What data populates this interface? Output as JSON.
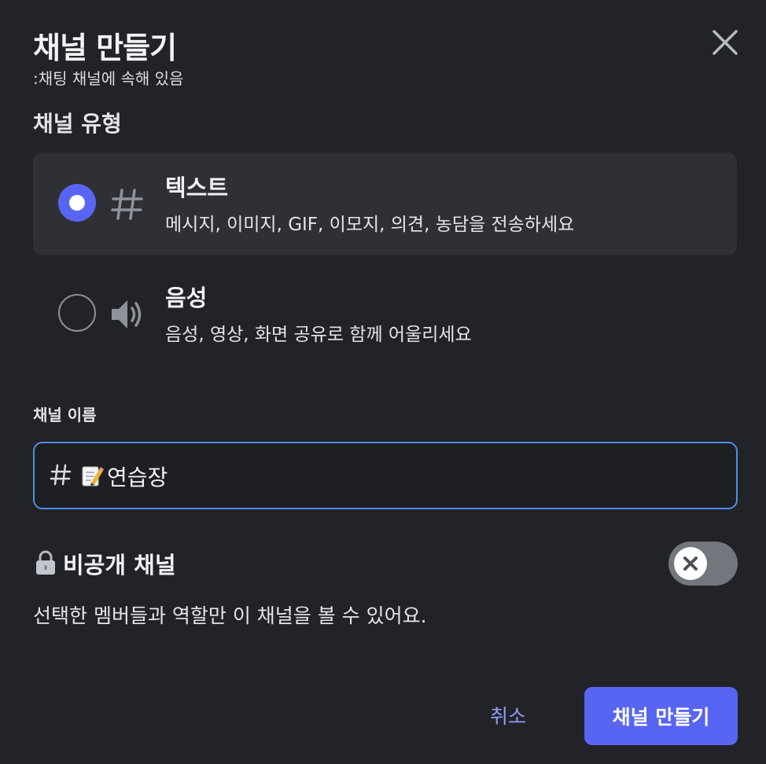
{
  "dialog": {
    "title": "채널 만들기",
    "subtitle": ":채팅 채널에 속해 있음",
    "close_icon": "close-icon"
  },
  "channel_type": {
    "label": "채널 유형",
    "options": [
      {
        "name": "텍스트",
        "description": "메시지, 이미지, GIF, 이모지, 의견, 농담을 전송하세요",
        "icon": "hash-icon",
        "selected": true
      },
      {
        "name": "음성",
        "description": "음성, 영상, 화면 공유로 함께 어울리세요",
        "icon": "speaker-icon",
        "selected": false
      }
    ]
  },
  "channel_name": {
    "label": "채널 이름",
    "prefix_icon": "hash-icon",
    "emoji": "📝",
    "value": "연습장"
  },
  "private_channel": {
    "label": "비공개 채널",
    "icon": "lock-icon",
    "enabled": false,
    "description": "선택한 멤버들과 역할만 이 채널을 볼 수 있어요."
  },
  "actions": {
    "cancel_label": "취소",
    "create_label": "채널 만들기"
  },
  "colors": {
    "background": "#222328",
    "accent": "#5865f2",
    "link": "#949cf7",
    "input_focus": "#4f8fea"
  }
}
